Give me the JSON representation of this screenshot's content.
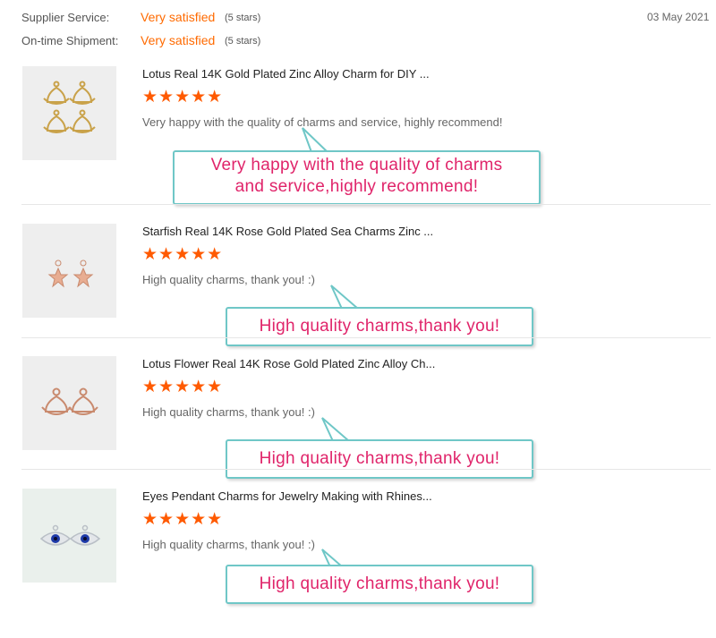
{
  "meta": {
    "supplier_label": "Supplier Service:",
    "supplier_value": "Very satisfied",
    "supplier_stars": "(5 stars)",
    "shipment_label": "On-time Shipment:",
    "shipment_value": "Very satisfied",
    "shipment_stars": "(5 stars)",
    "date": "03 May 2021"
  },
  "reviews": [
    {
      "title": "Lotus Real 14K Gold Plated Zinc Alloy Charm for DIY ...",
      "stars": "★★★★★",
      "rating": 5,
      "text": "Very happy with the quality of charms and service, highly recommend!",
      "callout_line1": "Very happy with the quality of charms",
      "callout_line2": "and service,highly recommend!",
      "image_icon": "gold-lotus-charms"
    },
    {
      "title": "Starfish Real 14K Rose Gold Plated Sea Charms Zinc ...",
      "stars": "★★★★★",
      "rating": 5,
      "text": "High quality charms, thank you! :)",
      "callout": "High quality charms,thank you!",
      "image_icon": "rose-gold-starfish-charms"
    },
    {
      "title": "Lotus Flower Real 14K Rose Gold Plated Zinc Alloy Ch...",
      "stars": "★★★★★",
      "rating": 5,
      "text": "High quality charms, thank you! :)",
      "callout": "High quality charms,thank you!",
      "image_icon": "rose-gold-lotus-charms"
    },
    {
      "title": "Eyes Pendant Charms for Jewelry Making with Rhines...",
      "stars": "★★★★★",
      "rating": 5,
      "text": "High quality charms, thank you! :)",
      "callout": "High quality charms,thank you!",
      "image_icon": "evil-eye-rhinestone-charms"
    }
  ],
  "colors": {
    "accent": "#ff6a00",
    "star": "#ff5a00",
    "callout_text": "#e0246a",
    "callout_border": "#6fc7c7"
  }
}
